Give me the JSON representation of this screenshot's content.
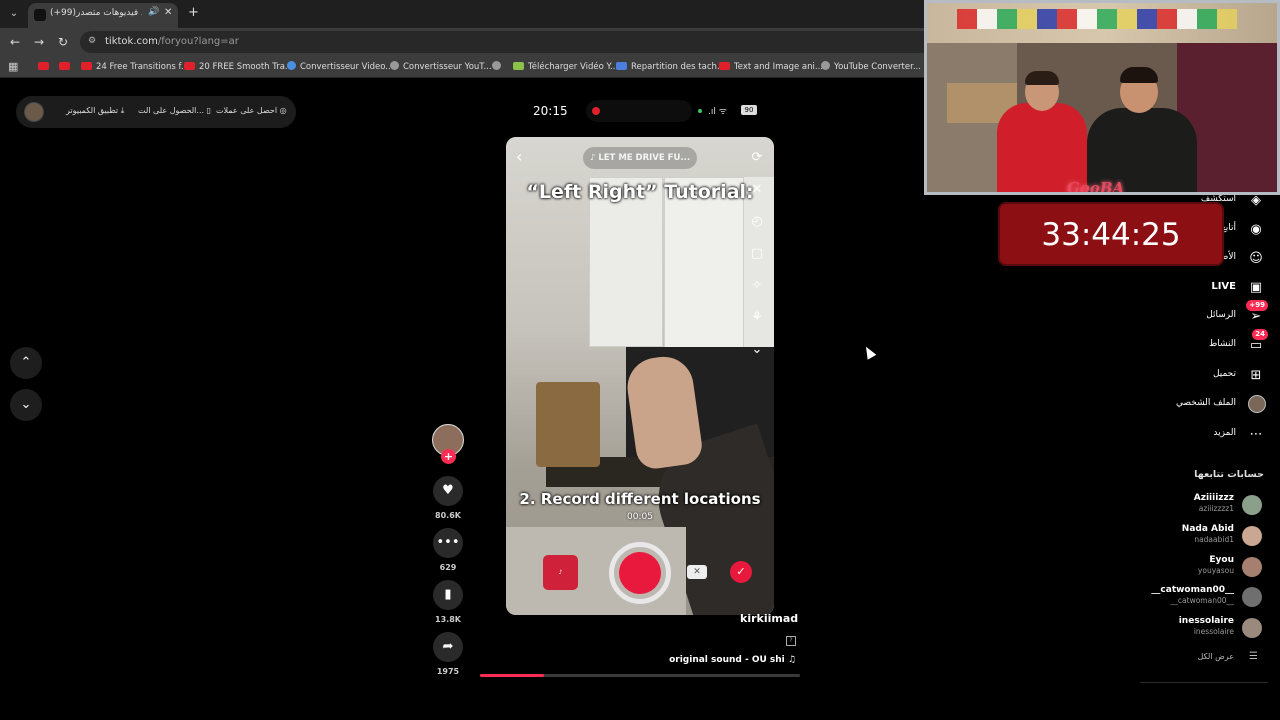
{
  "browser": {
    "tab_title": "(+99)شاهد فيديوهات متصدر",
    "tab_audio_icon": "speaker-icon",
    "url_host": "tiktok.com",
    "url_path": "/foryou?lang=ar",
    "bookmarks": [
      {
        "label": "",
        "icon": "youtube-icon"
      },
      {
        "label": "",
        "icon": "youtube-icon"
      },
      {
        "label": "24 Free Transitions f...",
        "icon": "youtube-icon"
      },
      {
        "label": "20 FREE Smooth Tra...",
        "icon": "youtube-icon"
      },
      {
        "label": "Convertisseur Video...",
        "icon": "google-icon"
      },
      {
        "label": "Convertisseur YouT...",
        "icon": "converter-icon"
      },
      {
        "label": "",
        "icon": "globe-icon"
      },
      {
        "label": "Télécharger Vidéo Y...",
        "icon": "download-icon"
      },
      {
        "label": "Repartition des tach...",
        "icon": "docs-icon"
      },
      {
        "label": "Text and Image ani...",
        "icon": "youtube-icon"
      },
      {
        "label": "YouTube Converter...",
        "icon": "globe-icon"
      }
    ]
  },
  "top_pill": {
    "get_coins": "احصل على عملات",
    "get_app": "الحصول على الت...",
    "desktop_app": "تطبيق الكمبيوتر"
  },
  "phone_status": {
    "time": "20:15",
    "battery": "90"
  },
  "video": {
    "music_chip": "♪ LET ME DRIVE FU...",
    "title_overlay": "“Left Right” Tutorial:",
    "caption": "2. Record different locations",
    "timer": "00:05",
    "progress_fraction": 0.2,
    "author": "kirkiimad",
    "sound": "original sound - OU shi",
    "actions": {
      "likes": "80.6K",
      "comments": "629",
      "saves": "13.8K",
      "shares": "1975"
    }
  },
  "sidebar": {
    "items": [
      {
        "label": "استكشف",
        "icon": "compass-icon"
      },
      {
        "label": "أتابع",
        "icon": "following-icon"
      },
      {
        "label": "الأصدقاء",
        "icon": "friends-icon"
      },
      {
        "label": "LIVE",
        "icon": "live-icon"
      },
      {
        "label": "الرسائل",
        "icon": "messages-icon",
        "badge": "+99"
      },
      {
        "label": "النشاط",
        "icon": "activity-icon",
        "badge": "24"
      },
      {
        "label": "تحميل",
        "icon": "upload-icon"
      },
      {
        "label": "الملف الشخصي",
        "icon": "profile-avatar"
      },
      {
        "label": "المزيد",
        "icon": "more-icon"
      }
    ],
    "following_title": "حسابات تتابعها",
    "accounts": [
      {
        "name": "Aziiiizzz",
        "handle": "aziiizzzz1"
      },
      {
        "name": "Nada Abid",
        "handle": "nadaabid1"
      },
      {
        "name": "Eyou",
        "handle": "youyasou"
      },
      {
        "name": "__catwoman00__",
        "handle": "__catwoman00__"
      },
      {
        "name": "inessolaire",
        "handle": "inessolaire"
      }
    ],
    "see_all": "عرض الكل"
  },
  "overlay": {
    "stream_logo": "GooBA",
    "stream_timer": "33:44:25"
  },
  "colors": {
    "accent": "#fe2c55",
    "timer_bg": "#8c0f14"
  }
}
